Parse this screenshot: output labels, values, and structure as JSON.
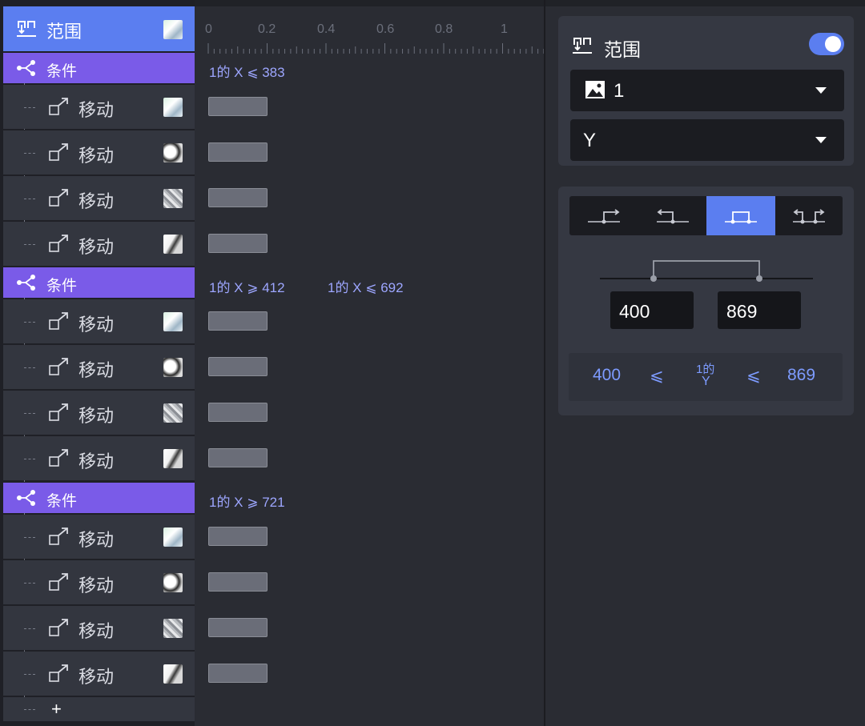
{
  "layers": {
    "range": {
      "label": "范围",
      "icon": "range-icon"
    },
    "groups": [
      {
        "condition_label": "条件",
        "conditions": [
          "1的 X ⩽ 383"
        ],
        "moves": [
          "移动",
          "移动",
          "移动",
          "移动"
        ]
      },
      {
        "condition_label": "条件",
        "conditions": [
          "1的 X ⩾ 412",
          "1的 X ⩽ 692"
        ],
        "moves": [
          "移动",
          "移动",
          "移动",
          "移动"
        ]
      },
      {
        "condition_label": "条件",
        "conditions": [
          "1的 X ⩾ 721"
        ],
        "moves": [
          "移动",
          "移动",
          "移动",
          "移动"
        ]
      }
    ],
    "add_label": "+"
  },
  "timeline": {
    "ticks": [
      "0",
      "0.2",
      "0.4",
      "0.6",
      "0.8",
      "1"
    ]
  },
  "panel": {
    "title": "范围",
    "toggle_on": true,
    "source_value": "1",
    "axis_value": "Y",
    "modes": [
      "range-out-right-icon",
      "range-out-left-icon",
      "range-inside-icon",
      "range-outside-icon"
    ],
    "active_mode": 2,
    "min_value": "400",
    "max_value": "869",
    "formula": {
      "min": "400",
      "op1": "⩽",
      "subject_top": "1的",
      "subject_bottom": "Y",
      "op2": "⩽",
      "max": "869"
    }
  },
  "colors": {
    "range_row": "#5b7ef0",
    "condition_row": "#7a5be8",
    "accent": "#5b7ef0",
    "formula_text": "#7d9bff"
  }
}
